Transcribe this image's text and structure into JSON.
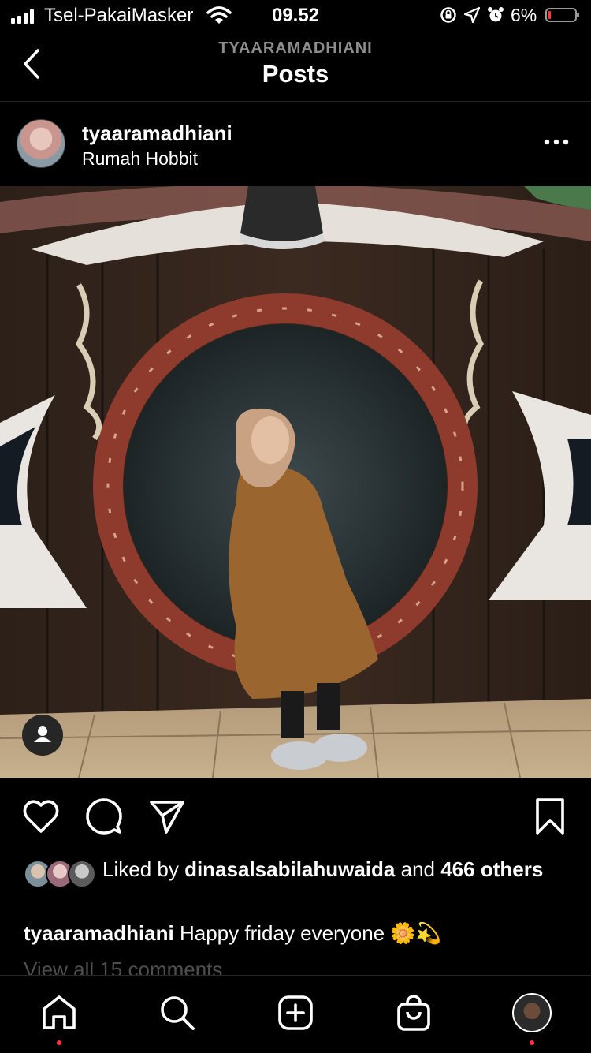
{
  "status_bar": {
    "carrier": "Tsel-PakaiMasker",
    "time": "09.52",
    "battery": "6%",
    "battery_level": 0.06
  },
  "nav": {
    "subtitle": "TYAARAMADHIANI",
    "title": "Posts"
  },
  "post": {
    "username": "tyaaramadhiani",
    "location": "Rumah Hobbit",
    "likes": {
      "prefix": "Liked by ",
      "user": "dinasalsabilahuwaida",
      "middle": " and ",
      "count": "466",
      "suffix": "others"
    },
    "caption": {
      "username": "tyaaramadhiani",
      "text": "Happy friday everyone 🌼💫"
    },
    "view_comments": "View all 15 comments"
  },
  "icons": {
    "back": "chevron-left-icon",
    "more": "more-horizontal-icon",
    "like": "heart-icon",
    "comment": "comment-icon",
    "share": "send-icon",
    "save": "bookmark-icon",
    "tag": "user-tag-icon",
    "home": "home-icon",
    "search": "search-icon",
    "create": "plus-square-icon",
    "shop": "shopping-bag-icon"
  },
  "colors": {
    "background": "#000000",
    "secondary_text": "#8e8e8e",
    "notification_dot": "#ff3040",
    "battery_low": "#ff3b30"
  }
}
